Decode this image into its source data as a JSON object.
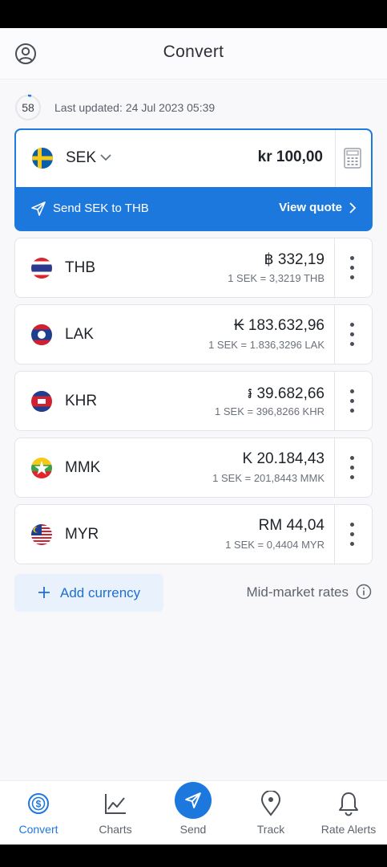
{
  "header": {
    "title": "Convert"
  },
  "status": {
    "countdown": "58",
    "updated_label": "Last updated:",
    "updated_value": "24 Jul 2023 05:39"
  },
  "base": {
    "code": "SEK",
    "amount": "kr 100,00",
    "send_label": "Send SEK to THB",
    "quote_label": "View quote"
  },
  "currencies": [
    {
      "code": "THB",
      "amount": "฿ 332,19",
      "rate": "1 SEK = 3,3219 THB",
      "flag": "thailand-flag-icon"
    },
    {
      "code": "LAK",
      "amount": "₭ 183.632,96",
      "rate": "1 SEK = 1.836,3296 LAK",
      "flag": "laos-flag-icon"
    },
    {
      "code": "KHR",
      "amount": "៛ 39.682,66",
      "rate": "1 SEK = 396,8266 KHR",
      "flag": "cambodia-flag-icon"
    },
    {
      "code": "MMK",
      "amount": "K 20.184,43",
      "rate": "1 SEK = 201,8443 MMK",
      "flag": "myanmar-flag-icon"
    },
    {
      "code": "MYR",
      "amount": "RM 44,04",
      "rate": "1 SEK = 0,4404 MYR",
      "flag": "malaysia-flag-icon"
    }
  ],
  "actions": {
    "add_currency": "Add currency",
    "mid_market": "Mid-market rates"
  },
  "nav": [
    {
      "label": "Convert",
      "icon": "convert-icon",
      "active": true
    },
    {
      "label": "Charts",
      "icon": "chart-icon",
      "active": false
    },
    {
      "label": "Send",
      "icon": "send-icon",
      "active": false
    },
    {
      "label": "Track",
      "icon": "location-pin-icon",
      "active": false
    },
    {
      "label": "Rate Alerts",
      "icon": "bell-icon",
      "active": false
    }
  ],
  "colors": {
    "accent": "#1d78dd",
    "background": "#f8f8fb"
  }
}
